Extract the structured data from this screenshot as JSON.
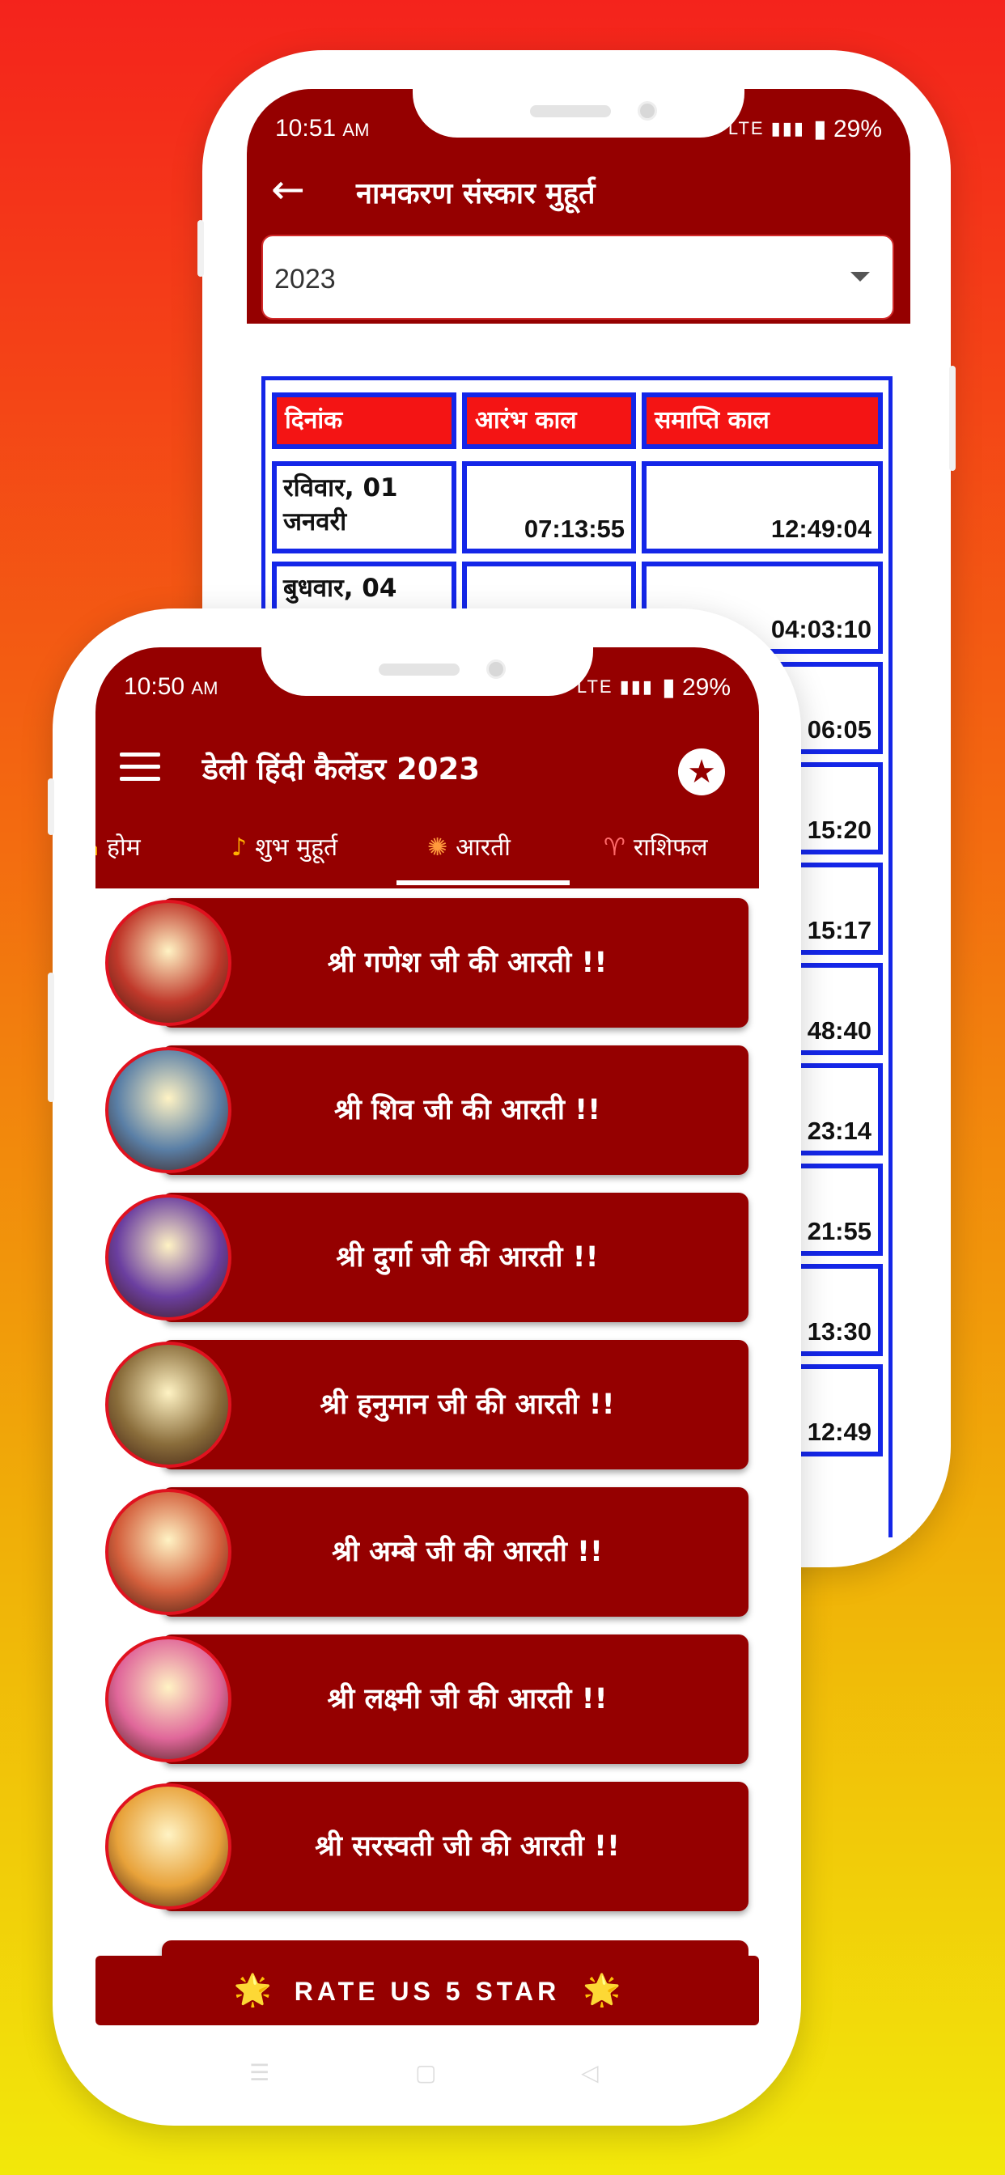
{
  "back_screen": {
    "status": {
      "time": "10:51",
      "ampm": "AM",
      "battery": "29%",
      "network": "LTE"
    },
    "title": "नामकरण संस्कार मुहूर्त",
    "year_select": {
      "value": "2023"
    },
    "table": {
      "headers": [
        "दिनांक",
        "आरंभ काल",
        "समाप्ति काल"
      ],
      "rows": [
        {
          "date": "रविवार, 01 जनवरी",
          "start": "07:13:55",
          "end": "12:49:04"
        },
        {
          "date": "बुधवार, 04",
          "start": "",
          "end": "04:03:10"
        },
        {
          "date": "",
          "start": "",
          "end": "06:05"
        },
        {
          "date": "",
          "start": "",
          "end": "15:20"
        },
        {
          "date": "",
          "start": "",
          "end": "15:17"
        },
        {
          "date": "",
          "start": "",
          "end": "48:40"
        },
        {
          "date": "",
          "start": "",
          "end": "23:14"
        },
        {
          "date": "",
          "start": "",
          "end": "21:55"
        },
        {
          "date": "",
          "start": "",
          "end": "13:30"
        },
        {
          "date": "",
          "start": "",
          "end": "12:49"
        }
      ]
    }
  },
  "front_screen": {
    "status": {
      "time": "10:50",
      "ampm": "AM",
      "battery": "29%",
      "network": "LTE"
    },
    "title": "डेली हिंदी कैलेंडर 2023",
    "tabs": [
      {
        "label": "होम",
        "icon": "home-icon",
        "glyph": "⌂"
      },
      {
        "label": "शुभ मुहूर्त",
        "icon": "trumpet-icon",
        "glyph": "♪"
      },
      {
        "label": "आरती",
        "icon": "aarti-lamp-icon",
        "glyph": "✺"
      },
      {
        "label": "राशिफल",
        "icon": "aries-icon",
        "glyph": "♈"
      }
    ],
    "active_tab": "आरती",
    "aarti_list": [
      {
        "label": "श्री गणेश जी की आरती !!",
        "image": "ganesh-image",
        "tint": "#c0392b"
      },
      {
        "label": "श्री शिव जी की आरती !!",
        "image": "shiv-image",
        "tint": "#5a7fa6"
      },
      {
        "label": "श्री दुर्गा जी की आरती !!",
        "image": "durga-image",
        "tint": "#6b3fa0"
      },
      {
        "label": "श्री हनुमान जी की आरती !!",
        "image": "hanuman-image",
        "tint": "#8a6d3b"
      },
      {
        "label": "श्री अम्बे जी की आरती !!",
        "image": "ambe-image",
        "tint": "#d35f3c"
      },
      {
        "label": "श्री लक्ष्मी जी की आरती !!",
        "image": "lakshmi-image",
        "tint": "#e0679a"
      },
      {
        "label": "श्री सरस्वती जी की आरती !!",
        "image": "saraswati-image",
        "tint": "#e8a23a"
      }
    ],
    "rate_button": {
      "label": "RATE US 5 STAR",
      "icon": "star-icon"
    }
  },
  "colors": {
    "primary": "#950000",
    "table_border": "#1426e8",
    "table_header": "#f41414",
    "accent_star": "#ffd21a"
  }
}
